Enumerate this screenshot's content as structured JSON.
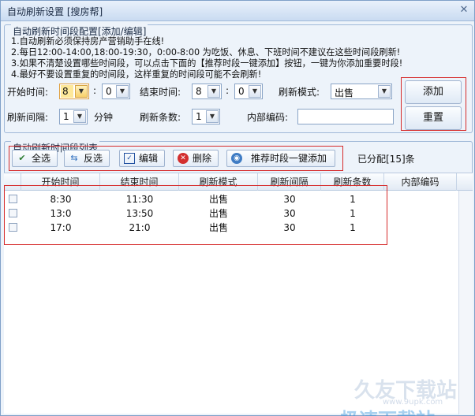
{
  "window": {
    "title": "自动刷新设置 [搜房帮]",
    "close_glyph": "✕"
  },
  "config": {
    "group_label": "自动刷新时间段配置[添加/编辑]",
    "notes": [
      "1.自动刷新必须保持房产营销助手在线!",
      "2.每日12:00-14:00,18:00-19:30，0:00-8:00 为吃饭、休息、下班时间不建议在这些时间段刷新!",
      "3.如果不清楚设置哪些时间段，可以点击下面的【推荐时段一键添加】按钮，一键为你添加重要时段!",
      "4.最好不要设置重复的时间段，这样重复的时间段可能不会刷新!"
    ],
    "start_time_label": "开始时间:",
    "start_hour": "8",
    "start_minute": "0",
    "colon": ":",
    "end_time_label": "结束时间:",
    "end_hour": "8",
    "end_minute": "0",
    "mode_label": "刷新模式:",
    "mode_value": "出售",
    "interval_label": "刷新间隔:",
    "interval_value": "1",
    "interval_unit": "分钟",
    "count_label": "刷新条数:",
    "count_value": "1",
    "code_label": "内部编码:",
    "code_value": "",
    "add_button": "添加",
    "reset_button": "重置"
  },
  "list": {
    "group_label": "自动刷新时间段列表",
    "toolbar": {
      "select_all": "全选",
      "invert": "反选",
      "edit": "编辑",
      "delete": "删除",
      "recommend": "推荐时段一键添加"
    },
    "assigned_text": "已分配[15]条",
    "columns": [
      "开始时间",
      "结束时间",
      "刷新模式",
      "刷新间隔",
      "刷新条数",
      "内部编码"
    ],
    "rows": [
      {
        "start": "8:30",
        "end": "11:30",
        "mode": "出售",
        "interval": "30",
        "count": "1",
        "code": ""
      },
      {
        "start": "13:0",
        "end": "13:50",
        "mode": "出售",
        "interval": "30",
        "count": "1",
        "code": ""
      },
      {
        "start": "17:0",
        "end": "21:0",
        "mode": "出售",
        "interval": "30",
        "count": "1",
        "code": ""
      }
    ]
  },
  "watermark": {
    "line1": "久友下载站",
    "line2": "www.9upk.com",
    "line3": "极速下载站"
  },
  "colors": {
    "highlight_box": "#d62a2a",
    "title_bg": "#c9dbf1",
    "combo_highlight": "#fde89a"
  }
}
